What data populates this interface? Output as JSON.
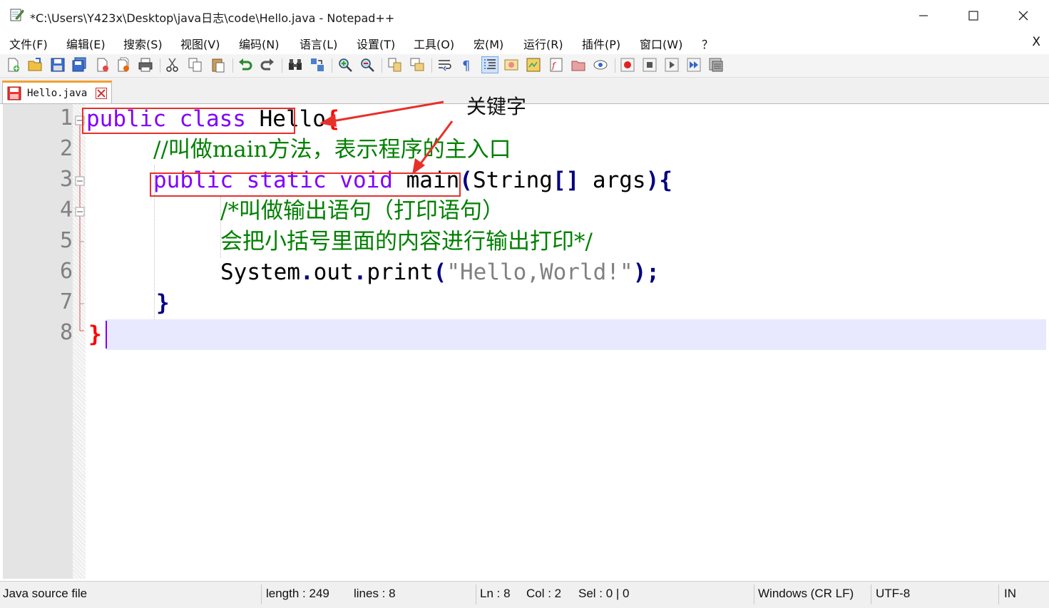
{
  "window": {
    "title": "*C:\\Users\\Y423x\\Desktop\\java日志\\code\\Hello.java - Notepad++",
    "minimize": "—",
    "maximize": "☐",
    "close": "✕"
  },
  "menu": {
    "items": [
      "文件(F)",
      "编辑(E)",
      "搜索(S)",
      "视图(V)",
      "编码(N)",
      "语言(L)",
      "设置(T)",
      "工具(O)",
      "宏(M)",
      "运行(R)",
      "插件(P)",
      "窗口(W)",
      "？"
    ],
    "close_doc": "X"
  },
  "toolbar": {
    "icons": [
      "new-file-icon",
      "open-file-icon",
      "save-icon",
      "save-all-icon",
      "close-icon",
      "close-all-icon",
      "print-icon",
      "cut-icon",
      "copy-icon",
      "paste-icon",
      "undo-icon",
      "redo-icon",
      "find-icon",
      "replace-icon",
      "zoom-in-icon",
      "zoom-out-icon",
      "sync-vertical-icon",
      "sync-horizontal-icon",
      "word-wrap-icon",
      "show-all-chars-icon",
      "indent-guide-icon",
      "user-lang-icon",
      "doc-map-icon",
      "function-list-icon",
      "folder-workspace-icon",
      "monitoring-icon",
      "record-macro-icon",
      "stop-macro-icon",
      "play-macro-icon",
      "run-macro-multiple-icon",
      "save-macro-icon"
    ]
  },
  "tab": {
    "label": "Hello.java"
  },
  "editor": {
    "line_numbers": [
      "1",
      "2",
      "3",
      "4",
      "5",
      "6",
      "7",
      "8"
    ],
    "lines": {
      "l1_kw": "public class",
      "l1_name": " Hello",
      "l1_brace": "{",
      "l2_comment": "//叫做main方法，表示程序的主入口",
      "l3_kw": "public static void",
      "l3_main": " main",
      "l3_paren": "(",
      "l3_type": "String",
      "l3_brackets": "[]",
      "l3_args": " args",
      "l3_close": "){",
      "l4_comment": "/*叫做输出语句（打印语句）",
      "l5_comment": "会把小括号里面的内容进行输出打印*/",
      "l6_sys": "System",
      "l6_dot1": ".",
      "l6_out": "out",
      "l6_dot2": ".",
      "l6_print": "print",
      "l6_open": "(",
      "l6_str": "\"Hello,World!\"",
      "l6_close": ");",
      "l7_brace": "}",
      "l8_brace": "}"
    },
    "annotation": "关键字"
  },
  "status": {
    "file_type": "Java source file",
    "length": "length : 249",
    "lines": "lines : 8",
    "ln": "Ln : 8",
    "col": "Col : 2",
    "sel": "Sel : 0 | 0",
    "eol": "Windows (CR LF)",
    "encoding": "UTF-8",
    "mode": "IN"
  },
  "colors": {
    "keyword": "#8000ff",
    "comment": "#008000",
    "operator": "#000080",
    "string": "#808080",
    "annotation": "#e8302a",
    "current_line": "#e8e8ff"
  }
}
